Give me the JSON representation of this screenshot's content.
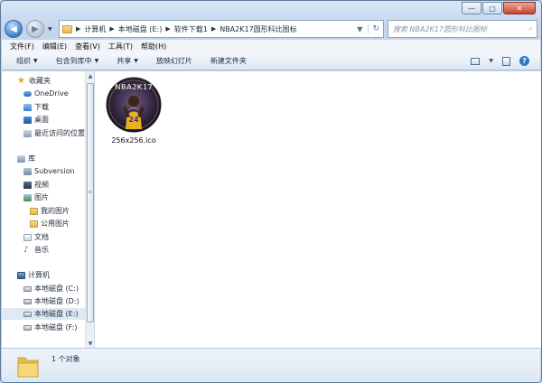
{
  "address": {
    "crumbs": [
      "计算机",
      "本地磁盘 (E:)",
      "软件下载1",
      "NBA2K17圆形科比图标"
    ]
  },
  "search": {
    "placeholder": "搜索 NBA2K17圆形科比图标"
  },
  "menu": [
    "文件(F)",
    "编辑(E)",
    "查看(V)",
    "工具(T)",
    "帮助(H)"
  ],
  "toolbar": {
    "organize": "组织",
    "include_library": "包含到库中",
    "share": "共享",
    "slideshow": "放映幻灯片",
    "new_folder": "新建文件夹"
  },
  "nav": {
    "favorites": "收藏夹",
    "onedrive": "OneDrive",
    "downloads": "下载",
    "desktop": "桌面",
    "recent": "最近访问的位置",
    "libraries": "库",
    "subversion": "Subversion",
    "videos": "视频",
    "pictures": "图片",
    "my_pictures": "我的图片",
    "public_pictures": "公用图片",
    "documents": "文档",
    "music": "音乐",
    "computer": "计算机",
    "drive_c": "本地磁盘 (C:)",
    "drive_d": "本地磁盘 (D:)",
    "drive_e": "本地磁盘 (E:)",
    "drive_f": "本地磁盘 (F:)"
  },
  "file": {
    "name": "256x256.ico",
    "icon_text": "NBA2K17",
    "jersey": "24"
  },
  "status": {
    "count": "1 个对象"
  }
}
